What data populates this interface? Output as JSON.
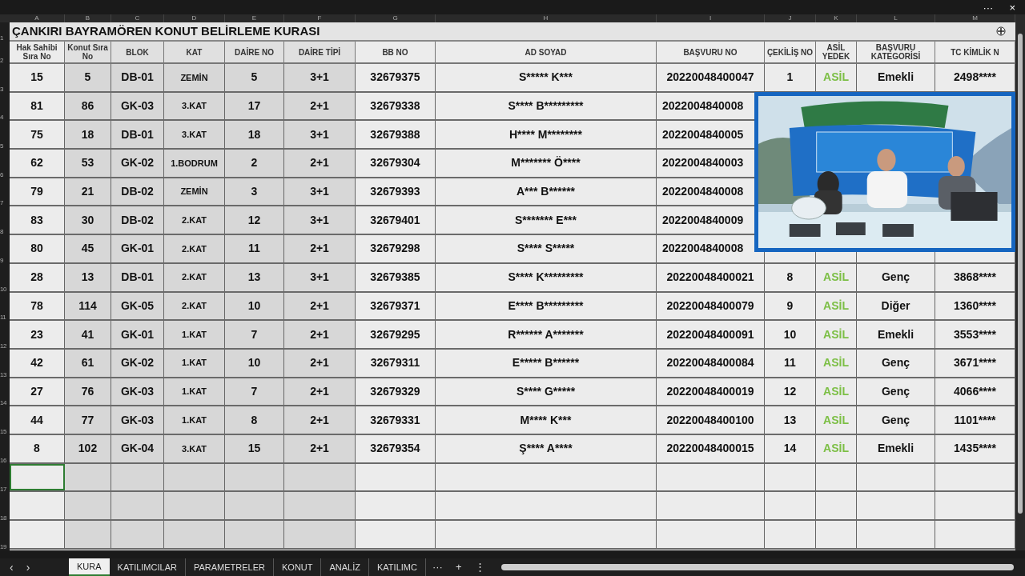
{
  "window": {
    "controls": [
      "···",
      "×"
    ]
  },
  "column_letters": [
    "A",
    "B",
    "C",
    "D",
    "E",
    "F",
    "G",
    "H",
    "I",
    "J",
    "K",
    "L",
    "M"
  ],
  "row_numbers": [
    "1",
    "2",
    "3",
    "4",
    "5",
    "6",
    "7",
    "8",
    "9",
    "10",
    "11",
    "12",
    "13",
    "14",
    "15",
    "16",
    "17",
    "18",
    "19"
  ],
  "title": "ÇANKIRI BAYRAMÖREN KONUT BELİRLEME KURASI",
  "columns": [
    "Hak Sahibi Sıra No",
    "Konut Sıra No",
    "BLOK",
    "KAT",
    "DAİRE NO",
    "DAİRE TİPİ",
    "BB NO",
    "AD SOYAD",
    "BAŞVURU NO",
    "ÇEKİLİŞ NO",
    "ASİL YEDEK",
    "BAŞVURU KATEGORİSİ",
    "TC KİMLİK N"
  ],
  "rows": [
    [
      "15",
      "5",
      "DB-01",
      "ZEMİN",
      "5",
      "3+1",
      "32679375",
      "S***** K***",
      "20220048400047",
      "1",
      "ASİL",
      "Emekli",
      "2498****"
    ],
    [
      "81",
      "86",
      "GK-03",
      "3.KAT",
      "17",
      "2+1",
      "32679338",
      "S**** B*********",
      "2022004840008"
    ],
    [
      "75",
      "18",
      "DB-01",
      "3.KAT",
      "18",
      "3+1",
      "32679388",
      "H**** M********",
      "2022004840005"
    ],
    [
      "62",
      "53",
      "GK-02",
      "1.BODRUM",
      "2",
      "2+1",
      "32679304",
      "M******* Ö****",
      "2022004840003"
    ],
    [
      "79",
      "21",
      "DB-02",
      "ZEMİN",
      "3",
      "3+1",
      "32679393",
      "A*** B******",
      "2022004840008"
    ],
    [
      "83",
      "30",
      "DB-02",
      "2.KAT",
      "12",
      "3+1",
      "32679401",
      "S******* E***",
      "2022004840009"
    ],
    [
      "80",
      "45",
      "GK-01",
      "2.KAT",
      "11",
      "2+1",
      "32679298",
      "S**** S*****",
      "2022004840008"
    ],
    [
      "28",
      "13",
      "DB-01",
      "2.KAT",
      "13",
      "3+1",
      "32679385",
      "S**** K*********",
      "20220048400021",
      "8",
      "ASİL",
      "Genç",
      "3868****"
    ],
    [
      "78",
      "114",
      "GK-05",
      "2.KAT",
      "10",
      "2+1",
      "32679371",
      "E**** B*********",
      "20220048400079",
      "9",
      "ASİL",
      "Diğer",
      "1360****"
    ],
    [
      "23",
      "41",
      "GK-01",
      "1.KAT",
      "7",
      "2+1",
      "32679295",
      "R****** A*******",
      "20220048400091",
      "10",
      "ASİL",
      "Emekli",
      "3553****"
    ],
    [
      "42",
      "61",
      "GK-02",
      "1.KAT",
      "10",
      "2+1",
      "32679311",
      "E***** B******",
      "20220048400084",
      "11",
      "ASİL",
      "Genç",
      "3671****"
    ],
    [
      "27",
      "76",
      "GK-03",
      "1.KAT",
      "7",
      "2+1",
      "32679329",
      "S**** G*****",
      "20220048400019",
      "12",
      "ASİL",
      "Genç",
      "4066****"
    ],
    [
      "44",
      "77",
      "GK-03",
      "1.KAT",
      "8",
      "2+1",
      "32679331",
      "M**** K***",
      "20220048400100",
      "13",
      "ASİL",
      "Genç",
      "1101****"
    ],
    [
      "8",
      "102",
      "GK-04",
      "3.KAT",
      "15",
      "2+1",
      "32679354",
      "Ş**** A****",
      "20220048400015",
      "14",
      "ASİL",
      "Emekli",
      "1435****"
    ]
  ],
  "video_overlay": {
    "kind": "picture"
  },
  "sheet_nav": [
    "‹",
    "›"
  ],
  "sheet_tabs": [
    {
      "label": "KURA",
      "selected": true
    },
    {
      "label": "KATILIMCILAR",
      "selected": false
    },
    {
      "label": "PARAMETRELER",
      "selected": false
    },
    {
      "label": "KONUT",
      "selected": false
    },
    {
      "label": "ANALİZ",
      "selected": false
    },
    {
      "label": "KATILIMC",
      "selected": false
    }
  ],
  "tab_controls": [
    "···",
    "+",
    "⋮"
  ]
}
